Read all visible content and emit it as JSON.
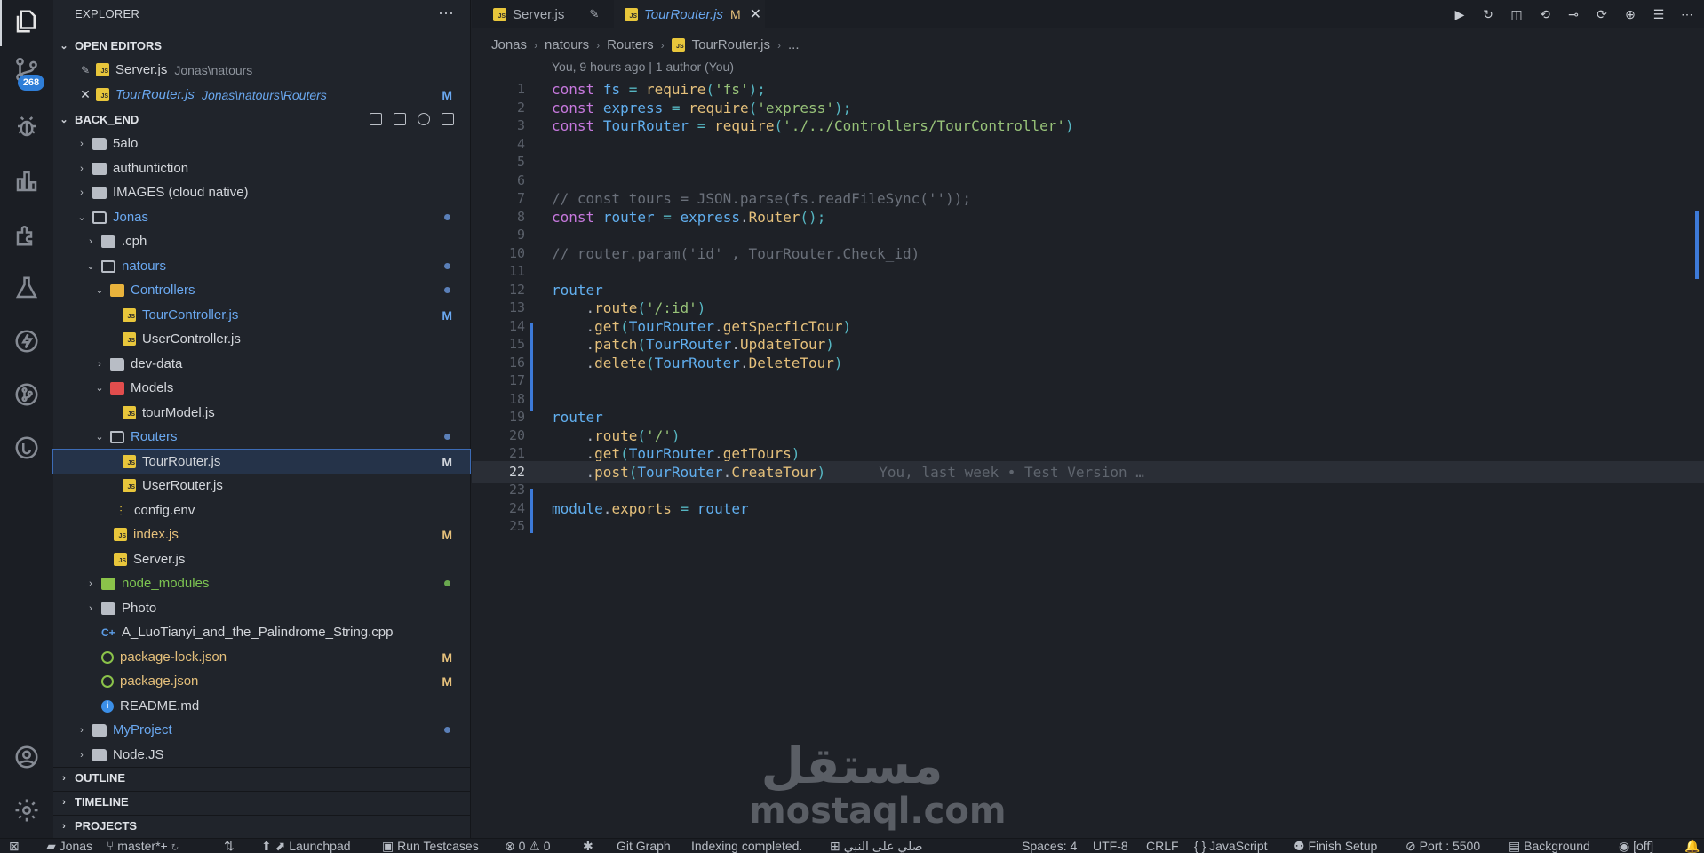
{
  "activity_bar": {
    "items": [
      "explorer-icon",
      "source-control-icon",
      "debug-icon",
      "charts-icon",
      "extensions-icon",
      "testing-icon",
      "thunder-client-icon",
      "git-graph-icon",
      "remote-icon",
      "account-icon",
      "settings-icon"
    ],
    "source_control_badge": "268"
  },
  "sidebar": {
    "title": "EXPLORER",
    "more": "···",
    "open_editors": {
      "label": "OPEN EDITORS",
      "items": [
        {
          "name": "Server.js",
          "desc": "Jonas\\natours",
          "mark": ""
        },
        {
          "name": "TourRouter.js",
          "desc": "Jonas\\natours\\Routers",
          "mark": "M"
        }
      ]
    },
    "back_end": {
      "label": "BACK_END",
      "rows": [
        {
          "name": "5alo",
          "mark": ""
        },
        {
          "name": "authuntiction",
          "mark": ""
        },
        {
          "name": "IMAGES (cloud native)",
          "mark": ""
        },
        {
          "name": "Jonas",
          "mark": ""
        },
        {
          "name": ".cph",
          "mark": ""
        },
        {
          "name": "natours",
          "mark": ""
        },
        {
          "name": "Controllers",
          "mark": ""
        },
        {
          "name": "TourController.js",
          "mark": "M"
        },
        {
          "name": "UserController.js",
          "mark": ""
        },
        {
          "name": "dev-data",
          "mark": ""
        },
        {
          "name": "Models",
          "mark": ""
        },
        {
          "name": "tourModel.js",
          "mark": ""
        },
        {
          "name": "Routers",
          "mark": ""
        },
        {
          "name": "TourRouter.js",
          "mark": "M"
        },
        {
          "name": "UserRouter.js",
          "mark": ""
        },
        {
          "name": "config.env",
          "mark": ""
        },
        {
          "name": "index.js",
          "mark": "M"
        },
        {
          "name": "Server.js",
          "mark": ""
        },
        {
          "name": "node_modules",
          "mark": ""
        },
        {
          "name": "Photo",
          "mark": ""
        },
        {
          "name": "A_LuoTianyi_and_the_Palindrome_String.cpp",
          "mark": ""
        },
        {
          "name": "package-lock.json",
          "mark": "M"
        },
        {
          "name": "package.json",
          "mark": "M"
        },
        {
          "name": "README.md",
          "mark": ""
        },
        {
          "name": "MyProject",
          "mark": ""
        },
        {
          "name": "Node.JS",
          "mark": ""
        }
      ]
    },
    "outline": "OUTLINE",
    "timeline": "TIMELINE",
    "projects": "PROJECTS"
  },
  "tabs": [
    {
      "label": "Server.js",
      "modified": "",
      "active": false
    },
    {
      "label": "TourRouter.js",
      "modified": "M",
      "active": true
    }
  ],
  "breadcrumb": [
    "Jonas",
    "natours",
    "Routers",
    "TourRouter.js",
    "..."
  ],
  "editor": {
    "blame_header": "You, 9 hours ago | 1 author (You)",
    "current_line": 22,
    "ghost_text": "You, last week • Test Version …",
    "lines": [
      "const fs = require('fs');",
      "const express = require('express');",
      "const TourRouter = require('./../Controllers/TourController')",
      "",
      "",
      "",
      "// const tours = JSON.parse(fs.readFileSync(''));",
      "const router = express.Router();",
      "",
      "// router.param('id' , TourRouter.Check_id)",
      "",
      "router",
      "    .route('/:id')",
      "    .get(TourRouter.getSpecficTour)",
      "    .patch(TourRouter.UpdateTour)",
      "    .delete(TourRouter.DeleteTour)",
      "",
      "",
      "router",
      "    .route('/')",
      "    .get(TourRouter.getTours)",
      "    .post(TourRouter.CreateTour)",
      "",
      "module.exports = router",
      ""
    ]
  },
  "status_bar": {
    "items": [
      "Jonas",
      "master*+",
      "Launchpad",
      "Run Testcases",
      "0",
      "0",
      "Git Graph",
      "Indexing completed.",
      "صلي على النبي",
      "Spaces: 4",
      "UTF-8",
      "CRLF",
      "{ } JavaScript",
      "Finish Setup",
      "Port : 5500",
      "Background",
      "[off]"
    ]
  },
  "watermark": {
    "arabic": "مستقل",
    "latin": "mostaql.com"
  }
}
